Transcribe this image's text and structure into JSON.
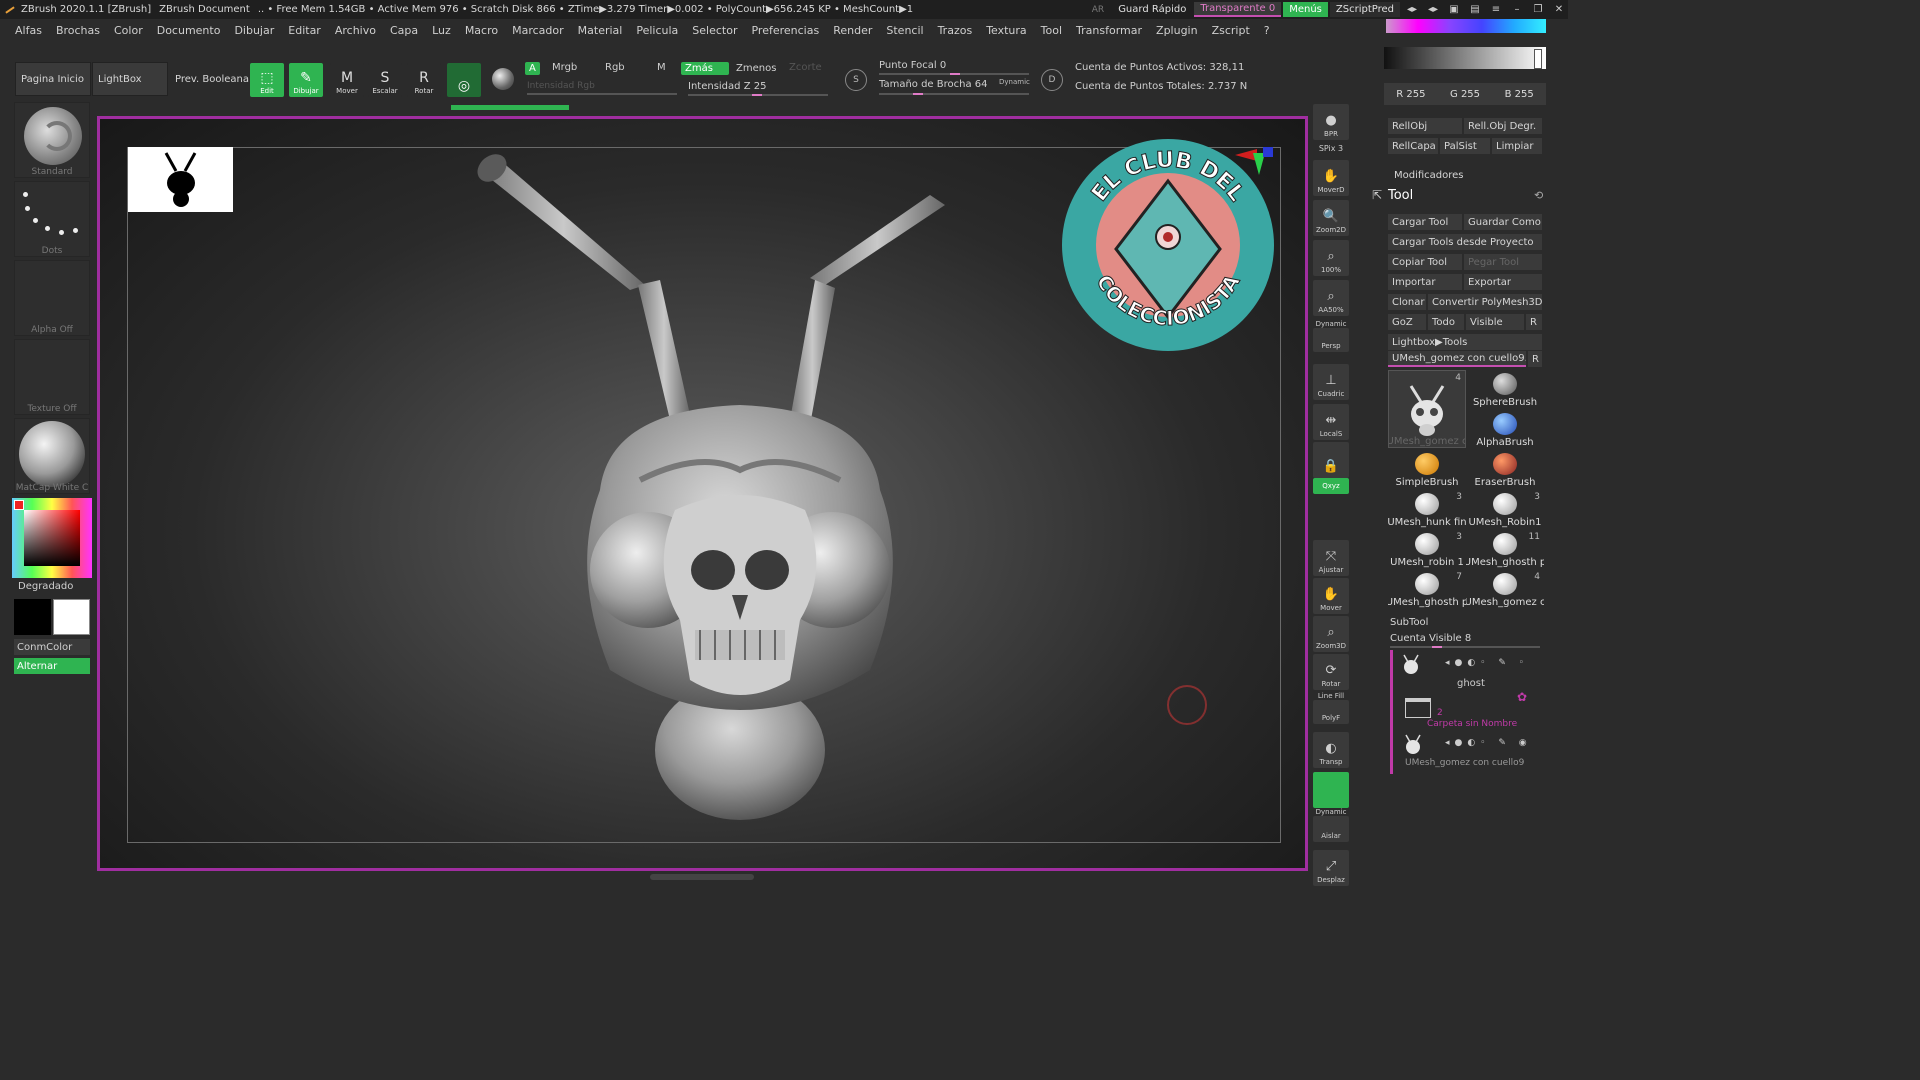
{
  "titlebar": {
    "app": "ZBrush 2020.1.1 [ZBrush]",
    "doc": "ZBrush Document",
    "stats": ".. • Free Mem 1.54GB • Active Mem 976 • Scratch Disk 866 • ZTime▶3.279 Timer▶0.002 • PolyCount▶656.245 KP  • MeshCount▶1",
    "ar": "AR",
    "quick_save": "Guard Rápido",
    "transparent": "Transparente 0",
    "menus": "Menús",
    "script": "ZScriptPred"
  },
  "menus": [
    "Alfas",
    "Brochas",
    "Color",
    "Documento",
    "Dibujar",
    "Editar",
    "Archivo",
    "Capa",
    "Luz",
    "Macro",
    "Marcador",
    "Material",
    "Pelicula",
    "Selector",
    "Preferencias",
    "Render",
    "Stencil",
    "Trazos",
    "Textura",
    "Tool",
    "Transformar",
    "Zplugin",
    "Zscript",
    "?"
  ],
  "toppal": {
    "home": "Pagina Inicio",
    "lightbox": "LightBox",
    "boolean": "Prev. Booleana",
    "edit": "Edit",
    "draw": "Dibujar",
    "move": "Mover",
    "scale": "Escalar",
    "rotate": "Rotar",
    "a_label": "A",
    "mrgb": "Mrgb",
    "rgb": "Rgb",
    "m": "M",
    "zadd": "Zmás",
    "zsub": "Zmenos",
    "zcut": "Zcorte",
    "rgb_intensity": "Intensidad Rgb",
    "z_intensity": "Intensidad Z 25",
    "focal": "Punto Focal 0",
    "brush_size": "Tamaño de Brocha 64",
    "dynamic": "Dynamic",
    "active_points": "Cuenta de Puntos Activos: 328,11",
    "total_points": "Cuenta de Puntos Totales: 2.737 N",
    "s_icon_label": "S",
    "d_icon_label": "D"
  },
  "colortop": {
    "r": "R 255",
    "g": "G 255",
    "b": "B 255"
  },
  "leftshelf": {
    "brush": "Standard",
    "stroke": "Dots",
    "alpha": "Alpha Off",
    "texture": "Texture Off",
    "material": "MatCap White C",
    "gradient": "Degradado",
    "main_color": "ConmColor",
    "alternate": "Alternar"
  },
  "rshelf": {
    "bpr": "BPR",
    "spix": "SPix 3",
    "move": "MoverD",
    "zoom2d": "Zoom2D",
    "pct100": "100%",
    "aahalf": "AA50%",
    "dynamic": "Dynamic",
    "persp": "Persp",
    "floor": "Cuadric",
    "local": "LocalS",
    "lock": "",
    "xyz": "Qxyz",
    "frame": "Ajustar",
    "move3d": "Mover",
    "zoom3d": "Zoom3D",
    "rotate": "Rotar",
    "linefill": "Line Fill",
    "polyf": "PolyF",
    "transp": "Transp",
    "dynamic2": "Dynamic",
    "solo": "Aislar",
    "xpose": "Desplaz"
  },
  "rpanel": {
    "btn_relobj": "RellObj",
    "btn_relobj_deg": "Rell.Obj Degr.",
    "btn_rellayer": "RellCapa",
    "btn_palsist": "PalSist",
    "btn_clear": "Limpiar",
    "modifiers": "Modificadores",
    "tool_title": "Tool",
    "load_tool": "Cargar Tool",
    "save_as": "Guardar Como",
    "load_project": "Cargar Tools desde Proyecto",
    "copy_tool": "Copiar Tool",
    "paste_tool": "Pegar Tool",
    "import": "Importar",
    "export": "Exportar",
    "clone": "Clonar",
    "convert": "Convertir PolyMesh3D",
    "goz": "GoZ",
    "all": "Todo",
    "visible": "Visible",
    "r": "R",
    "lightbox_tools": "Lightbox▶Tools",
    "current_tool": "UMesh_gomez con cuello9.",
    "current_r": "R",
    "tools": [
      {
        "name": "UMesh_gomez c",
        "count": "4"
      },
      {
        "name": "SphereBrush",
        "count": ""
      },
      {
        "name": "AlphaBrush",
        "count": ""
      },
      {
        "name": "SimpleBrush",
        "count": ""
      },
      {
        "name": "EraserBrush",
        "count": ""
      },
      {
        "name": "UMesh_hunk fin",
        "count": "3"
      },
      {
        "name": "UMesh_Robin1",
        "count": "3"
      },
      {
        "name": "UMesh_robin 1",
        "count": "3"
      },
      {
        "name": "UMesh_ghosth p",
        "count": "11"
      },
      {
        "name": "UMesh_ghosth p",
        "count": "7"
      },
      {
        "name": "UMesh_gomez c",
        "count": "4"
      }
    ],
    "subtool": "SubTool",
    "visible_count": "Cuenta Visible 8",
    "st_ghost": "ghost",
    "st_folder_num": "2",
    "st_folder": "Carpeta sin Nombre",
    "st_mesh": "UMesh_gomez con cuello9"
  },
  "canvas": {
    "logo_text_top": "EL CLUB DEL",
    "logo_text_bottom": "COLECCIONISTA"
  },
  "colors": {
    "accent_green": "#2fb451",
    "frame_magenta": "#a02ea0",
    "logo_teal": "#3aa7a3",
    "logo_pink": "#e28c86"
  }
}
